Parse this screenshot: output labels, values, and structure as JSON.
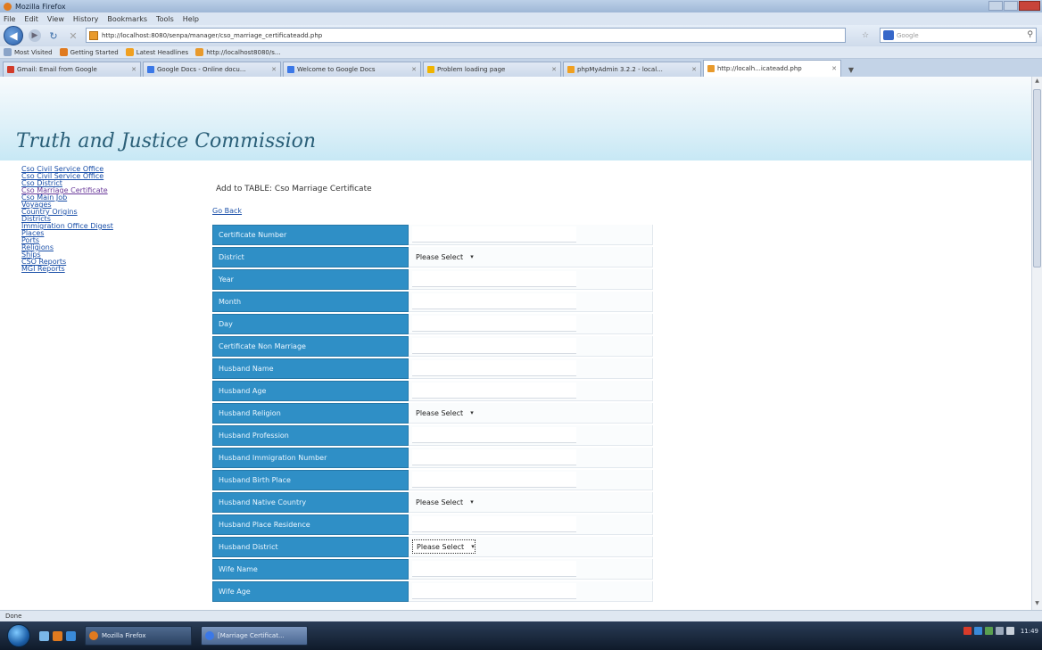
{
  "browser": {
    "window_title": "Mozilla Firefox",
    "menu": [
      "File",
      "Edit",
      "View",
      "History",
      "Bookmarks",
      "Tools",
      "Help"
    ],
    "url": "http://localhost:8080/senpa/manager/cso_marriage_certificateadd.php",
    "search_placeholder": "Google",
    "bookmarks": [
      "Most Visited",
      "Getting Started",
      "Latest Headlines",
      "http://localhost8080/s..."
    ],
    "tabs": [
      {
        "label": "Gmail: Email from Google",
        "active": false
      },
      {
        "label": "Google Docs - Online docu...",
        "active": false
      },
      {
        "label": "Welcome to Google Docs",
        "active": false
      },
      {
        "label": "Problem loading page",
        "active": false
      },
      {
        "label": "phpMyAdmin 3.2.2 - local...",
        "active": false
      },
      {
        "label": "http://localh...icateadd.php",
        "active": true
      }
    ],
    "status": "Done"
  },
  "site": {
    "title": "Truth and Justice Commission"
  },
  "sidebar": {
    "items": [
      "Cso Civil Service Office",
      "Cso Civil Service Office",
      "Cso District",
      "Cso Marriage Certificate",
      "Cso Main Job",
      "Voyages",
      "Country Origins",
      "Districts",
      "Immigration Office Digest",
      "Places",
      "Ports",
      "Religions",
      "Ships",
      "CSO Reports",
      "MGI Reports"
    ]
  },
  "form": {
    "heading": "Add to TABLE: Cso Marriage Certificate",
    "go_back": "Go Back",
    "select_placeholder": "Please Select",
    "fields": [
      {
        "label": "Certificate Number",
        "type": "text"
      },
      {
        "label": "District",
        "type": "select"
      },
      {
        "label": "Year",
        "type": "text"
      },
      {
        "label": "Month",
        "type": "text"
      },
      {
        "label": "Day",
        "type": "text"
      },
      {
        "label": "Certificate Non Marriage",
        "type": "text"
      },
      {
        "label": "Husband Name",
        "type": "text"
      },
      {
        "label": "Husband Age",
        "type": "text"
      },
      {
        "label": "Husband Religion",
        "type": "select"
      },
      {
        "label": "Husband Profession",
        "type": "text"
      },
      {
        "label": "Husband Immigration Number",
        "type": "text"
      },
      {
        "label": "Husband Birth Place",
        "type": "text"
      },
      {
        "label": "Husband Native Country",
        "type": "select"
      },
      {
        "label": "Husband Place Residence",
        "type": "text"
      },
      {
        "label": "Husband District",
        "type": "select"
      },
      {
        "label": "Wife Name",
        "type": "text"
      },
      {
        "label": "Wife Age",
        "type": "text"
      }
    ]
  },
  "taskbar": {
    "buttons": [
      "Mozilla Firefox",
      "[Marriage Certificat..."
    ],
    "clock": "11:49"
  },
  "colors": {
    "label_bg": "#2f8fc6",
    "header_bg": "#c7e8f5",
    "title_color": "#2a5f78",
    "link_color": "#1a4fa8"
  }
}
